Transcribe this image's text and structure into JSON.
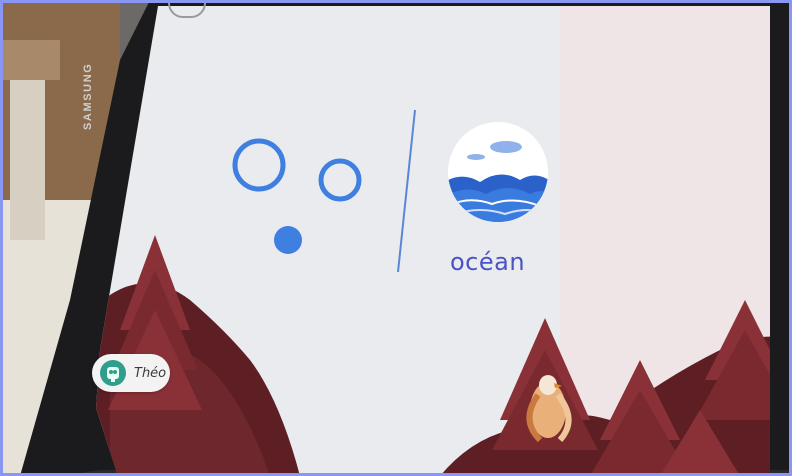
{
  "device": {
    "brand": "SAMSUNG"
  },
  "lesson": {
    "word": "océan",
    "image_icon": "ocean-wave-illustration",
    "sound_symbol_icon": "circles-symbol"
  },
  "profile": {
    "name": "Théo",
    "avatar_icon": "owl-avatar-icon"
  },
  "colors": {
    "accent_blue": "#3f7fe0",
    "word_color": "#4a53c6",
    "screen_bg": "#e9ebee",
    "tree_red": "#7a2a2e",
    "hill_red": "#5e1f24"
  }
}
